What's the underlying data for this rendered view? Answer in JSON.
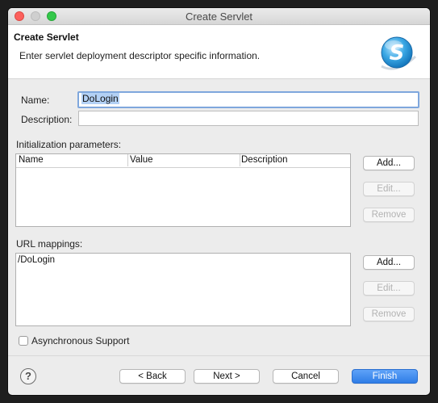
{
  "window": {
    "title": "Create Servlet"
  },
  "header": {
    "title": "Create Servlet",
    "description": "Enter servlet deployment descriptor specific information."
  },
  "form": {
    "name_label": "Name:",
    "name_value": "DoLogin",
    "description_label": "Description:",
    "description_value": ""
  },
  "init_params": {
    "label": "Initialization parameters:",
    "columns": [
      "Name",
      "Value",
      "Description"
    ],
    "rows": [],
    "buttons": {
      "add": "Add...",
      "edit": "Edit...",
      "remove": "Remove"
    }
  },
  "url_mappings": {
    "label": "URL mappings:",
    "items": [
      "/DoLogin"
    ],
    "buttons": {
      "add": "Add...",
      "edit": "Edit...",
      "remove": "Remove"
    }
  },
  "async_support": {
    "label": "Asynchronous Support",
    "checked": false
  },
  "footer": {
    "help_icon": "?",
    "back": "< Back",
    "next": "Next >",
    "cancel": "Cancel",
    "finish": "Finish"
  },
  "colors": {
    "accent": "#2f7de6",
    "close": "#fc605c",
    "maximize": "#34c84a",
    "selection": "#b3d1f5"
  },
  "icons": {
    "header_logo": "servlet-s-logo-icon",
    "help": "question-mark-icon"
  }
}
